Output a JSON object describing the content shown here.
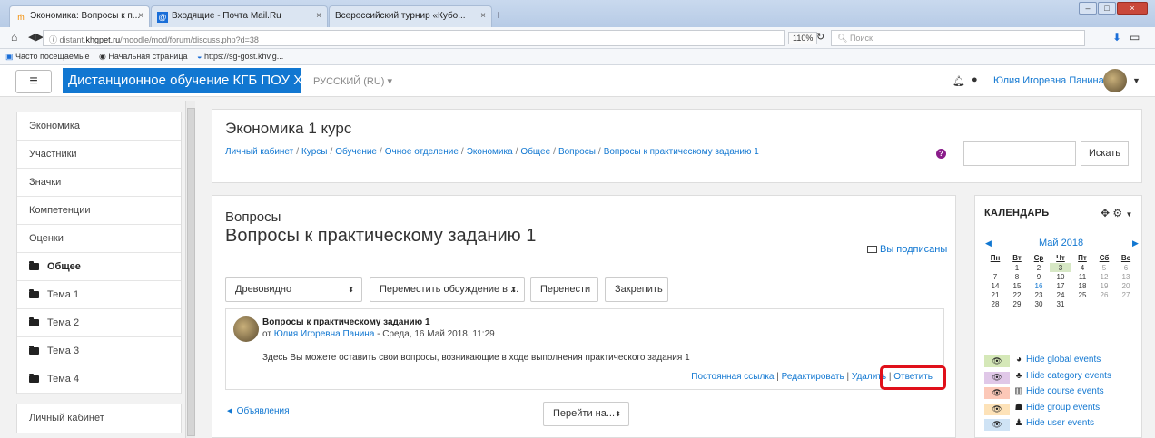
{
  "browser": {
    "tabs": [
      {
        "label": "Экономика: Вопросы к п...",
        "icon": "moodle-icon"
      },
      {
        "label": "Входящие - Почта Mail.Ru",
        "icon": "mail-icon"
      },
      {
        "label": "Всероссийский турнир «Кубо...",
        "icon": ""
      }
    ],
    "new_tab": "+",
    "url_prefix": "distant.",
    "url_domain": "khgpet.ru",
    "url_path": "/moodle/mod/forum/discuss.php?d=38",
    "zoom": "110%",
    "search_placeholder": "Поиск",
    "bookmarks": [
      "Часто посещаемые",
      "Начальная страница",
      "https://sg-gost.khv.g..."
    ]
  },
  "header": {
    "site_name": "Дистанционное обучение КГБ ПОУ ХПЭТ",
    "language": "РУССКИЙ (RU) ▾",
    "user_name": "Юлия Игоревна Панина"
  },
  "leftnav": {
    "items": [
      {
        "label": "Экономика",
        "folder": false,
        "bold": false
      },
      {
        "label": "Участники",
        "folder": false,
        "bold": false
      },
      {
        "label": "Значки",
        "folder": false,
        "bold": false
      },
      {
        "label": "Компетенции",
        "folder": false,
        "bold": false
      },
      {
        "label": "Оценки",
        "folder": false,
        "bold": false
      },
      {
        "label": "Общее",
        "folder": true,
        "bold": true
      },
      {
        "label": "Тема 1",
        "folder": true,
        "bold": false
      },
      {
        "label": "Тема 2",
        "folder": true,
        "bold": false
      },
      {
        "label": "Тема 3",
        "folder": true,
        "bold": false
      },
      {
        "label": "Тема 4",
        "folder": true,
        "bold": false
      }
    ],
    "dashboard": "Личный кабинет"
  },
  "pagehead": {
    "course_name": "Экономика 1 курс",
    "breadcrumb": [
      "Личный кабинет",
      "Курсы",
      "Обучение",
      "Очное отделение",
      "Экономика",
      "Общее",
      "Вопросы",
      "Вопросы к практическому заданию 1"
    ],
    "search_button": "Искать"
  },
  "forum": {
    "name": "Вопросы",
    "discussion_title": "Вопросы к практическому заданию 1",
    "subscribed": "Вы подписаны",
    "display_mode": "Древовидно",
    "move_select": "Переместить обсуждение в ...",
    "move_button": "Перенести",
    "pin_button": "Закрепить",
    "post": {
      "subject": "Вопросы к практическому заданию 1",
      "by_prefix": "от ",
      "author": "Юлия Игоревна Панина",
      "date": " - Среда, 16 Май 2018, 11:29",
      "body": "Здесь Вы можете оставить свои вопросы, возникающие в ходе выполнения практического задания 1",
      "commands": [
        "Постоянная ссылка",
        "Редактировать",
        "Удалить",
        "Ответить"
      ]
    },
    "prev_link": "◄ Объявления",
    "jump_to": "Перейти на..."
  },
  "calendar": {
    "title": "КАЛЕНДАРЬ",
    "month": "Май 2018",
    "weekdays": [
      "Пн",
      "Вт",
      "Ср",
      "Чт",
      "Пт",
      "Сб",
      "Вс"
    ],
    "weeks": [
      [
        "",
        "1",
        "2",
        "3",
        "4",
        "5",
        "6"
      ],
      [
        "7",
        "8",
        "9",
        "10",
        "11",
        "12",
        "13"
      ],
      [
        "14",
        "15",
        "16",
        "17",
        "18",
        "19",
        "20"
      ],
      [
        "21",
        "22",
        "23",
        "24",
        "25",
        "26",
        "27"
      ],
      [
        "28",
        "29",
        "30",
        "31",
        "",
        "",
        ""
      ]
    ],
    "event_day": "3",
    "today": "16",
    "event_toggles": [
      {
        "label": "Hide global events",
        "color": "#d5e8b8",
        "glyph": "globe-icon"
      },
      {
        "label": "Hide category events",
        "color": "#e0c8e8",
        "glyph": "users-icon"
      },
      {
        "label": "Hide course events",
        "color": "#fcc8b8",
        "glyph": "university-icon"
      },
      {
        "label": "Hide group events",
        "color": "#fde2b8",
        "glyph": "group-icon"
      },
      {
        "label": "Hide user events",
        "color": "#cfe3f5",
        "glyph": "user-icon"
      }
    ]
  },
  "colors": {
    "brand": "#1177d1",
    "highlight": "#e0101a"
  }
}
